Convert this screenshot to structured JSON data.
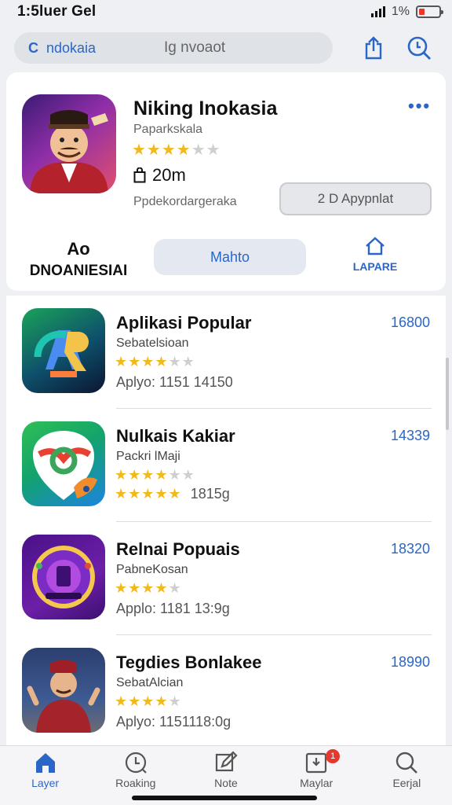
{
  "status": {
    "time": "1:5luer Gel",
    "battery_text": "1%"
  },
  "search": {
    "prefix": "C",
    "value": "ndokaia",
    "placeholder": "Ig nvoaot"
  },
  "hero": {
    "title": "Niking Inokasia",
    "subtitle": "Paparkskala",
    "size": "20m",
    "developer": "Ppdekordargeraka",
    "get_label": "2 D Apypnlat",
    "region_top": "Ao",
    "region_bottom": "DNOANIESIAI",
    "pill_label": "Mahto",
    "report_label": "LAPARE",
    "rating": 4
  },
  "apps": [
    {
      "name": "Aplikasi Popular",
      "category": "Sebatelsioan",
      "meta": "Aplyo:  1151 14150",
      "price": "16800",
      "rating": 4
    },
    {
      "name": "Nulkais Kakiar",
      "category": "Packri  lMaji",
      "meta_stars": 5,
      "meta": "1815g",
      "price": "14339",
      "rating": 4
    },
    {
      "name": "Relnai Popuais",
      "category": "PabneKosan",
      "meta": "Applo:  1181 13:9g",
      "price": "18320",
      "rating": 4
    },
    {
      "name": "Tegdies Bonlakee",
      "category": "SebatAlcian",
      "meta": "Aplyo:  1151118:0g",
      "price": "18990",
      "rating": 4
    }
  ],
  "tabs": [
    {
      "label": "Layer",
      "icon": "home-icon",
      "active": true
    },
    {
      "label": "Roaking",
      "icon": "ranking-icon"
    },
    {
      "label": "Note",
      "icon": "edit-icon"
    },
    {
      "label": "Maylar",
      "icon": "updates-icon",
      "badge": "1"
    },
    {
      "label": "Eerjal",
      "icon": "search-icon"
    }
  ],
  "colors": {
    "accent": "#2a66c8",
    "star": "#f2b91d",
    "badge": "#e5392d"
  }
}
